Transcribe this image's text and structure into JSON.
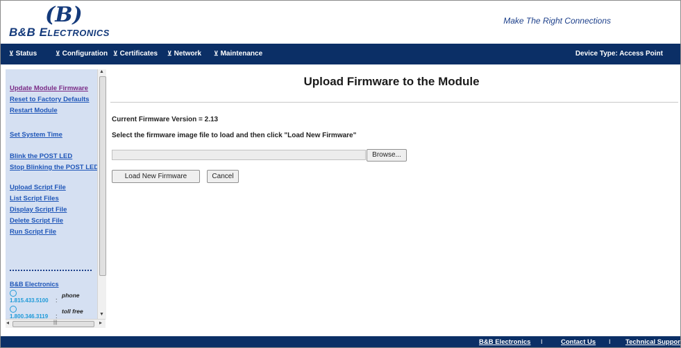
{
  "header": {
    "logo_mark": "(B)",
    "logo_bb": "B&B",
    "logo_e": "E",
    "logo_rest": "LECTRONICS",
    "tagline": "Make The Right Connections"
  },
  "nav": {
    "items": [
      {
        "label": "Status"
      },
      {
        "label": "Configuration"
      },
      {
        "label": "Certificates"
      },
      {
        "label": "Network"
      },
      {
        "label": "Maintenance"
      }
    ],
    "arrow": "⊻",
    "device_type": "Device Type: Access Point"
  },
  "sidebar": {
    "links": [
      {
        "label": "Update Module Firmware",
        "current": true
      },
      {
        "label": "Reset to Factory Defaults"
      },
      {
        "label": "Restart Module"
      },
      {
        "label": "Set System Time"
      },
      {
        "label": "Blink the POST LED"
      },
      {
        "label": "Stop Blinking the POST LED"
      },
      {
        "label": "Upload Script File"
      },
      {
        "label": "List Script Files"
      },
      {
        "label": "Display Script File"
      },
      {
        "label": "Delete Script File"
      },
      {
        "label": "Run Script File"
      }
    ],
    "company": "B&B Electronics",
    "contacts": [
      {
        "number": "1.815.433.5100",
        "separator": ":",
        "label": "phone"
      },
      {
        "number": "1.800.346.3119",
        "separator": ":",
        "label": "toll free"
      }
    ]
  },
  "main": {
    "title": "Upload Firmware to the Module",
    "current_version": "Current Firmware Version = 2.13",
    "instruction": "Select the firmware image file to load and then click \"Load New Firmware\"",
    "file_value": "",
    "browse_label": "Browse...",
    "load_label": "Load New Firmware",
    "cancel_label": "Cancel"
  },
  "footer": {
    "links": [
      {
        "label": "B&B Electronics"
      },
      {
        "label": "Contact Us"
      },
      {
        "label": "Technical Support"
      }
    ],
    "separator": "I"
  },
  "colors": {
    "nav_bg": "#0b2f66",
    "sidebar_bg": "#d5e0f2",
    "link": "#1f56b8",
    "visited_link": "#7a2b86",
    "brand": "#143a7b"
  }
}
